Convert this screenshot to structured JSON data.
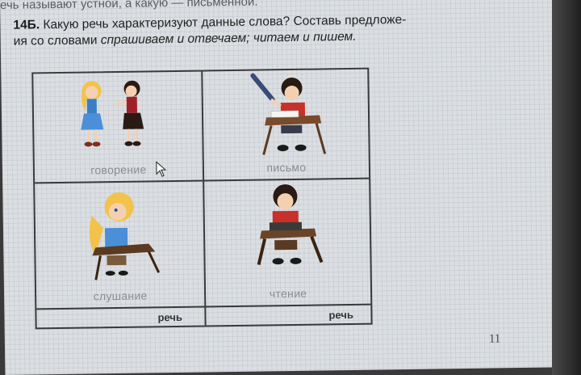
{
  "header": {
    "cut_text": "ечь называют устной, а какую — письменной.",
    "task_number": "14Б.",
    "task_line1": "Какую речь характеризуют данные слова? Составь предложе-",
    "task_line2_prefix": "ия со словами ",
    "task_word1": "спрашиваем и отвечаем;",
    "task_word2": " читаем и пишем."
  },
  "table": {
    "cells": [
      {
        "caption": "говорение",
        "illustration": "two-girls-talking"
      },
      {
        "caption": "письмо",
        "illustration": "boy-writing-with-pen"
      },
      {
        "caption": "слушание",
        "illustration": "girl-listening-at-desk"
      },
      {
        "caption": "чтение",
        "illustration": "boy-reading-at-desk"
      }
    ],
    "row_label_left": "речь",
    "row_label_right": "речь"
  },
  "page_number": "11",
  "colors": {
    "paper": "#dcdfe2",
    "ink": "#222222",
    "caption_gray": "#8a8e94"
  }
}
